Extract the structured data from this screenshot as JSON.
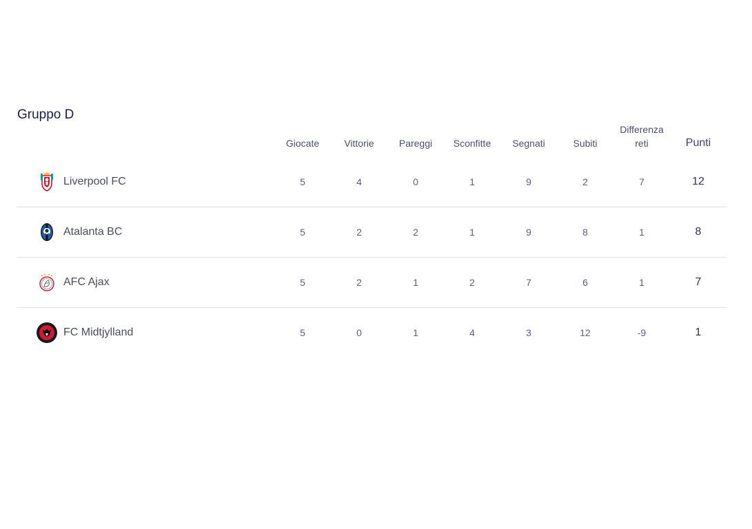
{
  "group": {
    "title": "Gruppo D"
  },
  "columns": {
    "played": "Giocate",
    "won": "Vittorie",
    "drawn": "Pareggi",
    "lost": "Sconfitte",
    "scored": "Segnati",
    "conceded": "Subiti",
    "goal_diff_line1": "Differenza",
    "goal_diff_line2": "reti",
    "points": "Punti"
  },
  "teams": [
    {
      "name": "Liverpool FC",
      "crest": "liverpool-crest-icon",
      "played": "5",
      "won": "4",
      "drawn": "0",
      "lost": "1",
      "scored": "9",
      "conceded": "2",
      "goal_diff": "7",
      "points": "12"
    },
    {
      "name": "Atalanta BC",
      "crest": "atalanta-crest-icon",
      "played": "5",
      "won": "2",
      "drawn": "2",
      "lost": "1",
      "scored": "9",
      "conceded": "8",
      "goal_diff": "1",
      "points": "8"
    },
    {
      "name": "AFC Ajax",
      "crest": "ajax-crest-icon",
      "played": "5",
      "won": "2",
      "drawn": "1",
      "lost": "2",
      "scored": "7",
      "conceded": "6",
      "goal_diff": "1",
      "points": "7"
    },
    {
      "name": "FC Midtjylland",
      "crest": "midtjylland-crest-icon",
      "played": "5",
      "won": "0",
      "drawn": "1",
      "lost": "4",
      "scored": "3",
      "conceded": "12",
      "goal_diff": "-9",
      "points": "1"
    }
  ],
  "colors": {
    "title": "#1b1c4d",
    "header_text": "#4b4d75",
    "cell_text": "#5b5d86",
    "divider": "#e2e2e6"
  }
}
